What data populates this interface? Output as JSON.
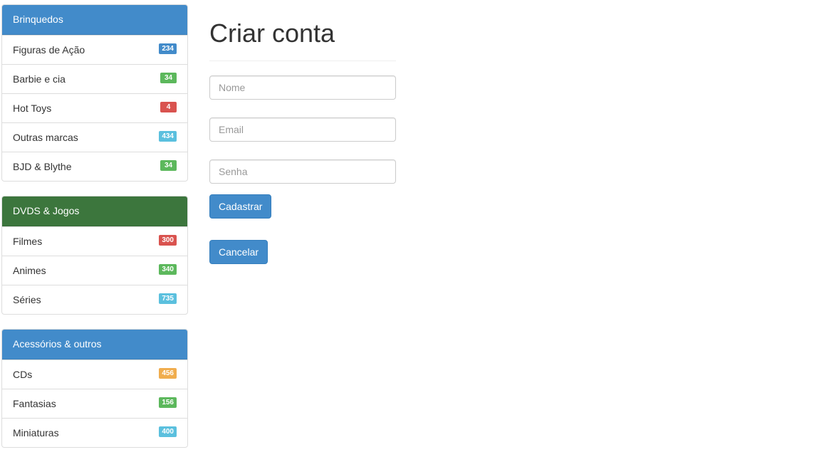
{
  "sidebar": {
    "panels": [
      {
        "heading": "Brinquedos",
        "color": "#428bca",
        "items": [
          {
            "label": "Figuras de Ação",
            "count": "234",
            "badge_color": "#428bca"
          },
          {
            "label": "Barbie e cia",
            "count": "34",
            "badge_color": "#5cb85c"
          },
          {
            "label": "Hot Toys",
            "count": "4",
            "badge_color": "#d9534f"
          },
          {
            "label": "Outras marcas",
            "count": "434",
            "badge_color": "#5bc0de"
          },
          {
            "label": "BJD & Blythe",
            "count": "34",
            "badge_color": "#5cb85c"
          }
        ]
      },
      {
        "heading": "DVDS & Jogos",
        "color": "#3c763d",
        "items": [
          {
            "label": "Filmes",
            "count": "300",
            "badge_color": "#d9534f"
          },
          {
            "label": "Animes",
            "count": "340",
            "badge_color": "#5cb85c"
          },
          {
            "label": "Séries",
            "count": "735",
            "badge_color": "#5bc0de"
          }
        ]
      },
      {
        "heading": "Acessórios & outros",
        "color": "#428bca",
        "items": [
          {
            "label": "CDs",
            "count": "456",
            "badge_color": "#f0ad4e"
          },
          {
            "label": "Fantasias",
            "count": "156",
            "badge_color": "#5cb85c"
          },
          {
            "label": "Miniaturas",
            "count": "400",
            "badge_color": "#5bc0de"
          }
        ]
      }
    ]
  },
  "form": {
    "title": "Criar conta",
    "name_placeholder": "Nome",
    "email_placeholder": "Email",
    "password_placeholder": "Senha",
    "submit_label": "Cadastrar",
    "cancel_label": "Cancelar"
  }
}
